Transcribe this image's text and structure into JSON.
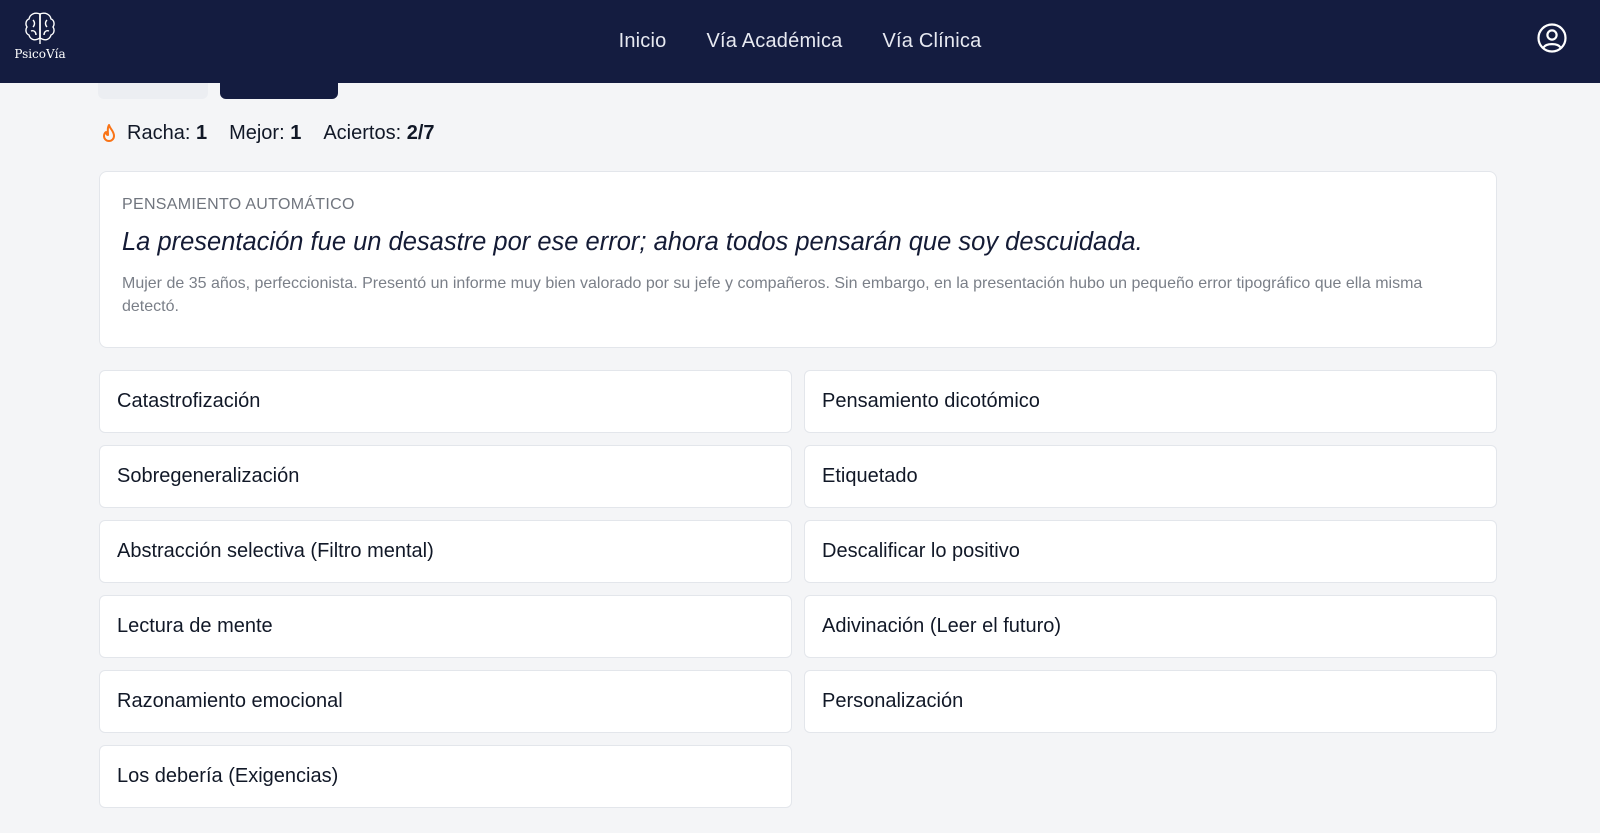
{
  "header": {
    "logo_text": "PsicoVía",
    "nav": [
      "Inicio",
      "Vía Académica",
      "Vía Clínica"
    ]
  },
  "stats": {
    "streak_label": "Racha:",
    "streak_value": "1",
    "best_label": "Mejor:",
    "best_value": "1",
    "hits_label": "Aciertos:",
    "hits_value": "2/7"
  },
  "card": {
    "label": "Pensamiento automático",
    "thought": "La presentación fue un desastre por ese error; ahora todos pensarán que soy descuidada.",
    "description": "Mujer de 35 años, perfeccionista. Presentó un informe muy bien valorado por su jefe y compañeros. Sin embargo, en la presentación hubo un pequeño error tipográfico que ella misma detectó."
  },
  "options": [
    "Catastrofización",
    "Pensamiento dicotómico",
    "Sobregeneralización",
    "Etiquetado",
    "Abstracción selectiva (Filtro mental)",
    "Descalificar lo positivo",
    "Lectura de mente",
    "Adivinación (Leer el futuro)",
    "Razonamiento emocional",
    "Personalización",
    "Los debería (Exigencias)"
  ],
  "colors": {
    "header_bg": "#141c40",
    "accent_flame": "#f97316",
    "page_bg": "#f4f5f7"
  },
  "icons": [
    "brain-logo-icon",
    "user-circle-icon",
    "flame-icon"
  ]
}
